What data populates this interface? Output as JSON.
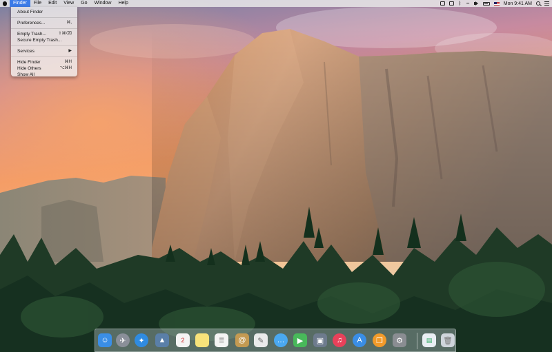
{
  "menubar": {
    "apple_icon": "apple-logo-icon",
    "items": [
      {
        "label": "Finder",
        "active": true
      },
      {
        "label": "File"
      },
      {
        "label": "Edit"
      },
      {
        "label": "View"
      },
      {
        "label": "Go"
      },
      {
        "label": "Window"
      },
      {
        "label": "Help"
      }
    ],
    "clock": "Mon 9:41 AM",
    "status_icons": [
      "notification-icon",
      "screen-icon",
      "bluetooth-icon",
      "wifi-icon",
      "volume-icon",
      "battery-icon",
      "flag-icon",
      "search-icon",
      "list-icon"
    ]
  },
  "finder_menu": {
    "items": [
      {
        "label": "About Finder",
        "shortcut": ""
      },
      {
        "label": "Preferences...",
        "shortcut": "⌘,"
      },
      {
        "label": "Empty Trash...",
        "shortcut": "⇧⌘⌫"
      },
      {
        "label": "Secure Empty Trash...",
        "shortcut": ""
      },
      {
        "label": "Services",
        "shortcut": "▶"
      },
      {
        "label": "Hide Finder",
        "shortcut": "⌘H"
      },
      {
        "label": "Hide Others",
        "shortcut": "⌥⌘H"
      },
      {
        "label": "Show All",
        "shortcut": ""
      }
    ]
  },
  "dock": {
    "apps": [
      {
        "icon": "finder-icon",
        "color": "#3a8ee6"
      },
      {
        "icon": "launchpad-icon",
        "color": "#8a8f99"
      },
      {
        "icon": "safari-icon",
        "color": "#2f8be0"
      },
      {
        "icon": "photo-icon",
        "color": "#5a7fa8"
      },
      {
        "icon": "calendar-icon",
        "color": "#f4f4f4",
        "text": "2"
      },
      {
        "icon": "notes-icon",
        "color": "#f7e27a"
      },
      {
        "icon": "reminders-icon",
        "color": "#f4f4f4"
      },
      {
        "icon": "contacts-icon",
        "color": "#c49a52"
      },
      {
        "icon": "preview-icon",
        "color": "#eaeaea"
      },
      {
        "icon": "messages-icon",
        "color": "#4aa8f0"
      },
      {
        "icon": "facetime-icon",
        "color": "#48b85a"
      },
      {
        "icon": "photo-booth-icon",
        "color": "#6d7b8d"
      },
      {
        "icon": "itunes-icon",
        "color": "#e8415a"
      },
      {
        "icon": "app-store-icon",
        "color": "#3a8ee6"
      },
      {
        "icon": "ibooks-icon",
        "color": "#f19a2a"
      },
      {
        "icon": "system-preferences-icon",
        "color": "#8a8d92"
      },
      {
        "icon": "documents-icon",
        "color": "#e9eef3"
      },
      {
        "icon": "trash-icon",
        "color": "#cfd5dc"
      }
    ]
  },
  "colors": {
    "menu_highlight": "#3b7be8",
    "sky_top": "#7f8fb5",
    "sky_glow": "#f39a64",
    "rock": "#b98a62",
    "forest": "#1f3a26"
  }
}
